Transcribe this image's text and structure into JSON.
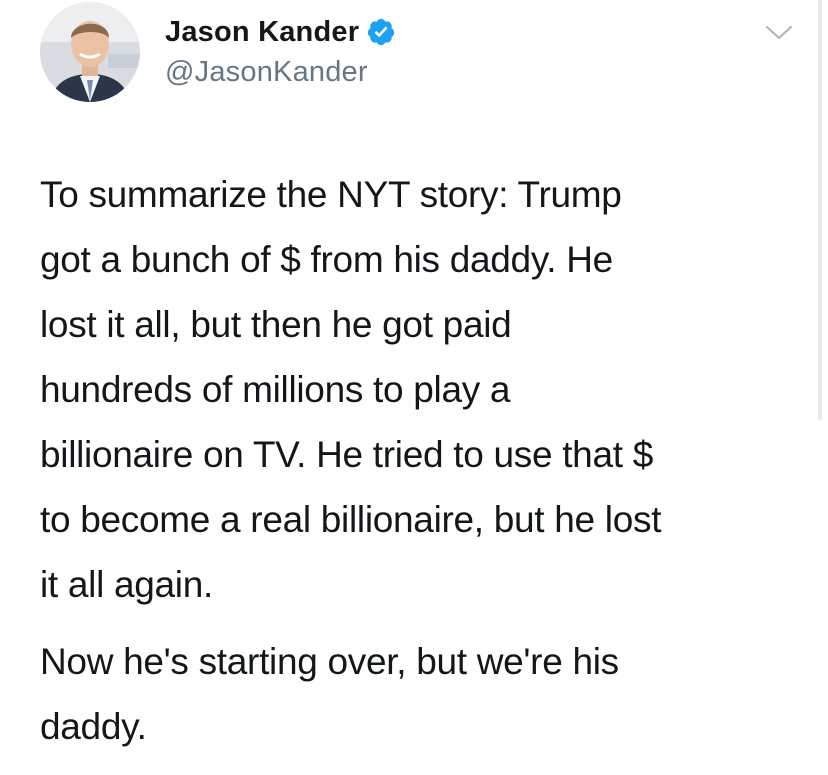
{
  "author": {
    "display_name": "Jason Kander",
    "handle": "@JasonKander",
    "verified": true,
    "avatar_icon": "profile-photo"
  },
  "tweet": {
    "paragraphs": [
      "To summarize the NYT story: Trump\ngot a bunch of $ from his daddy. He\nlost it all, but then he got paid\nhundreds of millions to play a\nbillionaire on TV. He tried to use that $\nto become a real billionaire, but he lost\nit all again.",
      "Now he's starting over, but we're his\ndaddy."
    ]
  },
  "icons": {
    "verified": "verified-badge-icon",
    "menu": "chevron-down-icon"
  },
  "colors": {
    "text": "#14171a",
    "secondary_text": "#657786",
    "verified_blue": "#1da1f2",
    "background": "#ffffff"
  }
}
